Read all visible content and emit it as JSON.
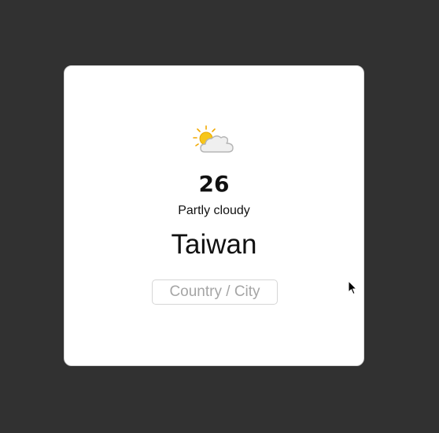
{
  "weather": {
    "icon": "partly-cloudy-icon",
    "temperature": "26",
    "condition": "Partly cloudy",
    "location": "Taiwan"
  },
  "search": {
    "placeholder": "Country / City",
    "value": ""
  },
  "colors": {
    "background": "#313131",
    "card": "#ffffff",
    "sun": "#f5c518",
    "cloud": "#ececec"
  }
}
